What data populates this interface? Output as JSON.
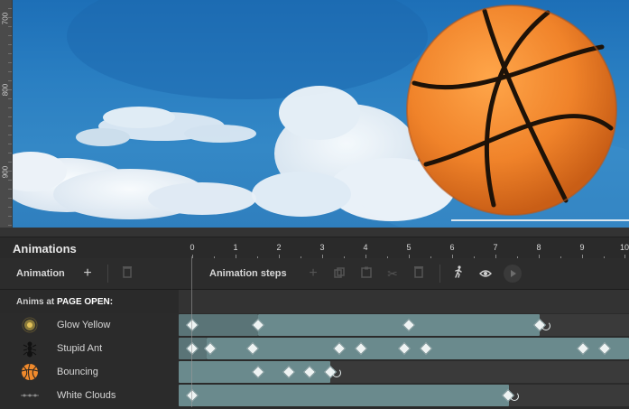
{
  "ruler": {
    "labels": [
      "700",
      "800",
      "900"
    ]
  },
  "panel": {
    "title": "Animations"
  },
  "timeline": {
    "numbers": [
      "0",
      "1",
      "2",
      "3",
      "4",
      "5",
      "6",
      "7",
      "8",
      "9",
      "10"
    ]
  },
  "toolbar": {
    "animation_label": "Animation",
    "steps_label": "Animation steps",
    "icons": [
      "plus-icon",
      "trash-icon",
      "add-step-icon",
      "copy-icon",
      "paste-icon",
      "cut-icon",
      "delete-step-icon",
      "walk-icon",
      "eye-icon",
      "play-icon"
    ]
  },
  "anims_header": {
    "prefix": "Anims at",
    "event": "PAGE OPEN:"
  },
  "animations": [
    {
      "name": "Glow Yellow",
      "thumb": "glow-icon"
    },
    {
      "name": "Stupid Ant",
      "thumb": "ant-icon"
    },
    {
      "name": "Bouncing",
      "thumb": "basketball-icon"
    },
    {
      "name": "White Clouds",
      "thumb": "clouds-icon"
    }
  ],
  "colors": {
    "accent_bar": "#6a8a8d",
    "track_bg": "#3a3a3a",
    "panel_bg": "#2b2b2b",
    "sky": "#2a7fc2",
    "ball": "#f08a2c"
  }
}
